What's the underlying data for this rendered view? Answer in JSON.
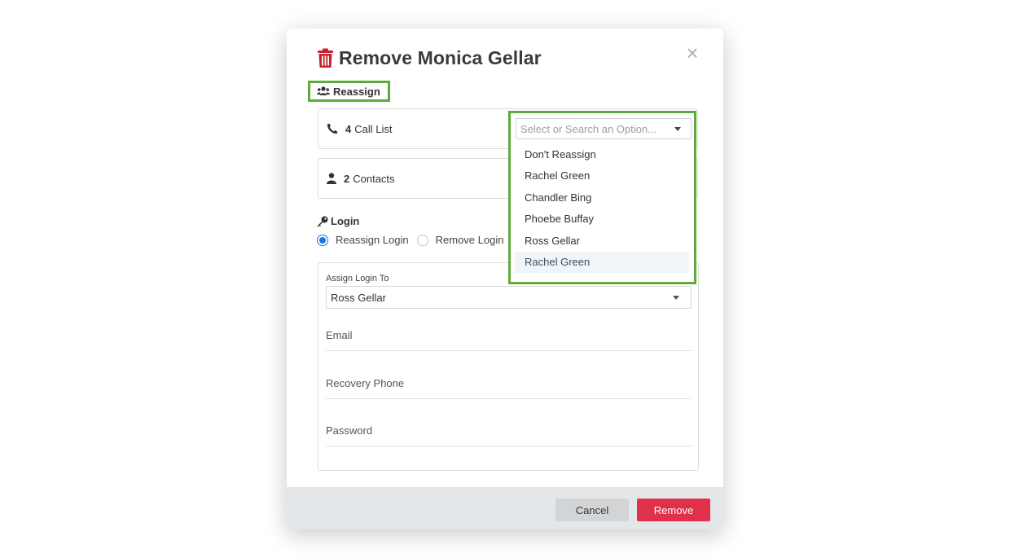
{
  "modal": {
    "title": "Remove Monica Gellar",
    "close_glyph": "×"
  },
  "reassign": {
    "heading": "Reassign",
    "rows": [
      {
        "count": "4",
        "label": "Call List",
        "icon": "phone-icon"
      },
      {
        "count": "2",
        "label": "Contacts",
        "icon": "user-icon"
      }
    ]
  },
  "login": {
    "heading": "Login",
    "options": [
      "Reassign Login",
      "Remove Login"
    ],
    "selected": "Reassign Login",
    "assign_label": "Assign Login To",
    "assign_value": "Ross Gellar",
    "fields": [
      "Email",
      "Recovery Phone",
      "Password"
    ]
  },
  "dropdown": {
    "placeholder": "Select or Search an Option...",
    "options": [
      "Don't Reassign",
      "Rachel Green",
      "Chandler Bing",
      "Phoebe Buffay",
      "Ross Gellar",
      "Rachel Green"
    ],
    "highlighted_index": 5
  },
  "footer": {
    "cancel_label": "Cancel",
    "remove_label": "Remove"
  },
  "colors": {
    "accent_green": "#5eaa3a",
    "danger_red": "#e0314a",
    "trash_red": "#c8202f",
    "radio_blue": "#1a73e8"
  }
}
